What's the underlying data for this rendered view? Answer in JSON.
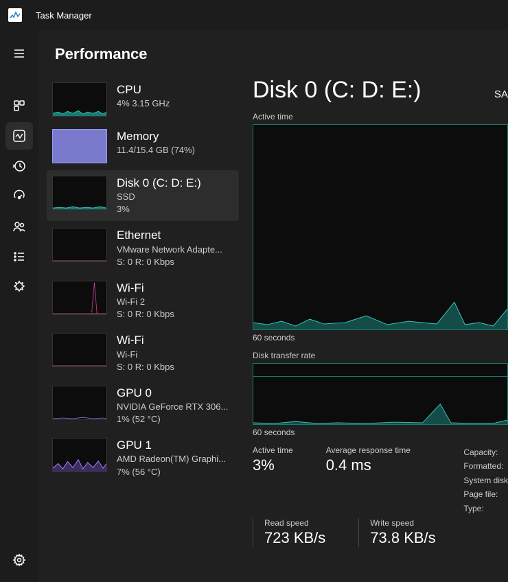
{
  "app": {
    "title": "Task Manager"
  },
  "page": {
    "title": "Performance"
  },
  "sidebar": {
    "items": [
      {
        "title": "CPU",
        "sub1": "4%  3.15 GHz",
        "sub2": "",
        "color": "#36c5b9",
        "pattern": "cpu"
      },
      {
        "title": "Memory",
        "sub1": "11.4/15.4 GB (74%)",
        "sub2": "",
        "color": "#7a7acc",
        "pattern": "fill"
      },
      {
        "title": "Disk 0 (C: D: E:)",
        "sub1": "SSD",
        "sub2": "3%",
        "color": "#36c5b9",
        "pattern": "disk",
        "selected": true
      },
      {
        "title": "Ethernet",
        "sub1": "VMware Network Adapte...",
        "sub2": "S: 0 R: 0 Kbps",
        "color": "#a06060",
        "pattern": "flat"
      },
      {
        "title": "Wi-Fi",
        "sub1": "Wi-Fi 2",
        "sub2": "S: 0 R: 0 Kbps",
        "color": "#ff4dc4",
        "pattern": "spike"
      },
      {
        "title": "Wi-Fi",
        "sub1": "Wi-Fi",
        "sub2": "S: 0 R: 0 Kbps",
        "color": "#a06060",
        "pattern": "flat"
      },
      {
        "title": "GPU 0",
        "sub1": "NVIDIA GeForce RTX 306...",
        "sub2": "1%  (52 °C)",
        "color": "#8866cc",
        "pattern": "gpu0"
      },
      {
        "title": "GPU 1",
        "sub1": "AMD Radeon(TM) Graphi...",
        "sub2": "7%  (56 °C)",
        "color": "#b080ff",
        "pattern": "gpu1"
      }
    ]
  },
  "detail": {
    "title": "Disk 0 (C: D: E:)",
    "vendor": "SA",
    "chart1_label": "Active time",
    "chart2_label": "Disk transfer rate",
    "xaxis": "60 seconds",
    "stats": {
      "active_time": {
        "label": "Active time",
        "value": "3%"
      },
      "avg_response": {
        "label": "Average response time",
        "value": "0.4 ms"
      },
      "read_speed": {
        "label": "Read speed",
        "value": "723 KB/s"
      },
      "write_speed": {
        "label": "Write speed",
        "value": "73.8 KB/s"
      }
    },
    "meta": {
      "capacity": "Capacity:",
      "formatted": "Formatted:",
      "system_disk": "System disk",
      "page_file": "Page file:",
      "type": "Type:"
    }
  },
  "chart_data": [
    {
      "type": "area",
      "title": "Active time",
      "xlabel": "60 seconds",
      "ylabel": "",
      "ylim": [
        0,
        100
      ],
      "x": [
        0,
        5,
        10,
        15,
        20,
        25,
        30,
        35,
        40,
        45,
        48,
        50,
        55,
        58,
        60
      ],
      "values": [
        4,
        3,
        5,
        2,
        6,
        3,
        4,
        8,
        3,
        5,
        14,
        3,
        4,
        2,
        10
      ]
    },
    {
      "type": "area",
      "title": "Disk transfer rate",
      "xlabel": "60 seconds",
      "ylabel": "",
      "ylim": [
        0,
        100
      ],
      "x": [
        0,
        5,
        10,
        15,
        20,
        25,
        30,
        35,
        40,
        45,
        48,
        50,
        55,
        58,
        60
      ],
      "values": [
        2,
        1,
        3,
        1,
        2,
        0,
        1,
        3,
        1,
        2,
        28,
        2,
        1,
        0,
        4
      ]
    }
  ]
}
